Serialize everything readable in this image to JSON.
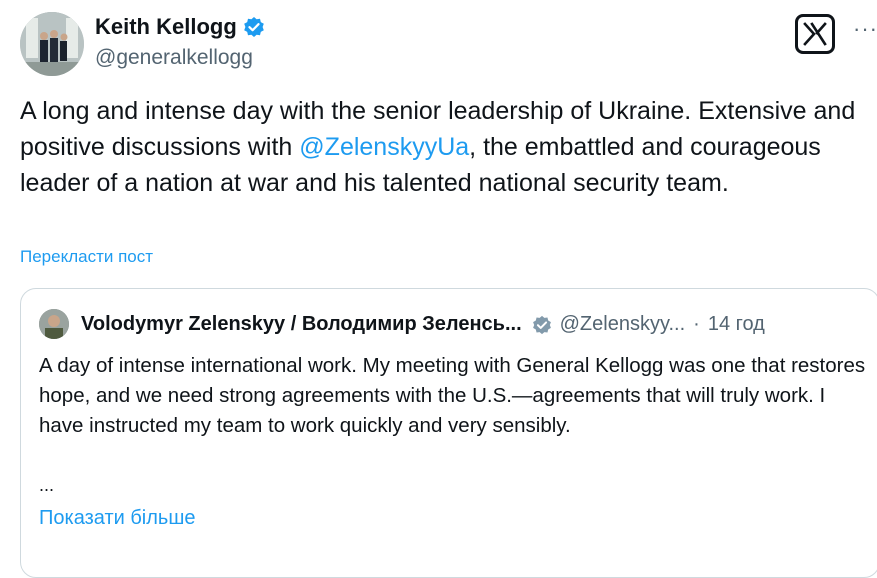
{
  "author": {
    "name": "Keith Kellogg",
    "handle": "@generalkellogg",
    "avatar_icon": "profile-photo"
  },
  "header": {
    "logo_icon": "x-logo-icon",
    "more_label": "···"
  },
  "post": {
    "text_before": "A long and intense day with the senior leadership of Ukraine.  Extensive and positive discussions with ",
    "mention": "@ZelenskyyUa",
    "text_after": ", the embattled and courageous leader of a nation at war and his talented national security team.",
    "translate_label": "Перекласти пост"
  },
  "quote": {
    "name": "Volodymyr Zelenskyy / Володимир Зеленсь...",
    "handle": "@Zelenskyy...",
    "separator": "·",
    "time": "14 год",
    "text": "A day of intense international work. My meeting with General Kellogg was one that restores hope, and we need strong agreements with the U.S.—agreements that will truly work. I have instructed my team to work quickly and very sensibly.",
    "ellipsis": "...",
    "show_more_label": "Показати більше"
  },
  "colors": {
    "link": "#1d9bf0",
    "text": "#0f1419",
    "muted": "#536471",
    "border": "#cfd9de"
  }
}
